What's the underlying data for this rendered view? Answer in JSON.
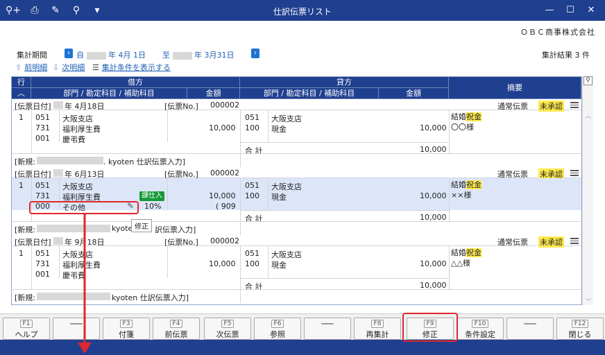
{
  "window": {
    "title": "仕訳伝票リスト",
    "toolbar_icons": [
      "search-add-icon",
      "print-icon",
      "pdf-icon",
      "preview-icon",
      "dropdown-icon"
    ],
    "minimize": "—",
    "maximize": "☐",
    "close": "✕"
  },
  "company": "ＯＢＣ商事株式会社",
  "period": {
    "label": "集計期間",
    "from_prefix": "自",
    "from_date": "年  4月 1日",
    "to_prefix": "至",
    "to_date": "年  3月31日"
  },
  "result": "集計結果 3 件",
  "links": {
    "prev": "前明細",
    "next": "次明細",
    "show_conditions": "集計条件を表示する"
  },
  "grid": {
    "col_row": "行",
    "col_debit": "借方",
    "col_credit": "貸方",
    "col_dept_account": "部門 / 勘定科目 / 補助科目",
    "col_amount": "金額",
    "col_summary": "摘要"
  },
  "slips": [
    {
      "date_label": "[伝票日付]",
      "date": "年  4月18日",
      "no_label": "[伝票No.]",
      "no": "000002",
      "type": "通常伝票",
      "status": "未承認",
      "row": "1",
      "debit": [
        [
          "051",
          "大阪支店"
        ],
        [
          "731",
          "福利厚生費"
        ],
        [
          "001",
          "慶弔費"
        ]
      ],
      "debit_amount": "10,000",
      "credit": [
        [
          "051",
          "大阪支店"
        ],
        [
          "100",
          "現金"
        ]
      ],
      "credit_amount": "10,000",
      "summary1_a": "結婚",
      "summary1_b": "祝金",
      "summary2": "〇〇様",
      "total_label": "合 計",
      "total": "10,000",
      "new_label": "[新規:",
      "new_user": ". kyoten  仕訳伝票入力]"
    },
    {
      "date_label": "[伝票日付]",
      "date": "年  6月13日",
      "no_label": "[伝票No.]",
      "no": "000002",
      "type": "通常伝票",
      "status": "未承認",
      "row": "1",
      "debit": [
        [
          "051",
          "大阪支店"
        ],
        [
          "731",
          "福利厚生費"
        ],
        [
          "000",
          "その他"
        ]
      ],
      "tax_badge": "課仕入",
      "tax_rate": "10%",
      "debit_amount": "10,000",
      "tax_amount": "( 909",
      "credit": [
        [
          "051",
          "大阪支店"
        ],
        [
          "100",
          "現金"
        ]
      ],
      "credit_amount": "10,000",
      "summary1_a": "結婚",
      "summary1_b": "祝金",
      "summary2": "××様",
      "total_label": "合 計",
      "total": "10,000",
      "new_label": "[新規:",
      "new_user": "kyoten",
      "new_user_tail": "訳伝票入力]",
      "tooltip": "修正"
    },
    {
      "date_label": "[伝票日付]",
      "date": "年  9月18日",
      "no_label": "[伝票No.]",
      "no": "000002",
      "type": "通常伝票",
      "status": "未承認",
      "row": "1",
      "debit": [
        [
          "051",
          "大阪支店"
        ],
        [
          "731",
          "福利厚生費"
        ],
        [
          "001",
          "慶弔費"
        ]
      ],
      "debit_amount": "10,000",
      "credit": [
        [
          "051",
          "大阪支店"
        ],
        [
          "100",
          "現金"
        ]
      ],
      "credit_amount": "10,000",
      "summary1_a": "結婚",
      "summary1_b": "祝金",
      "summary2": "△△様",
      "total_label": "合 計",
      "total": "10,000",
      "new_label": "[新規:",
      "new_user": "kyoten  仕訳伝票入力]"
    }
  ],
  "fkeys": [
    {
      "key": "F1",
      "label": "ヘルプ"
    },
    {
      "key": "",
      "label": ""
    },
    {
      "key": "F3",
      "label": "付箋"
    },
    {
      "key": "F4",
      "label": "前伝票"
    },
    {
      "key": "F5",
      "label": "次伝票"
    },
    {
      "key": "F6",
      "label": "参照"
    },
    {
      "key": "",
      "label": ""
    },
    {
      "key": "F8",
      "label": "再集計"
    },
    {
      "key": "F9",
      "label": "修正"
    },
    {
      "key": "F10",
      "label": "条件設定"
    },
    {
      "key": "",
      "label": ""
    },
    {
      "key": "F12",
      "label": "閉じる"
    }
  ],
  "colors": {
    "accent": "#1f3f8f",
    "highlight_row": "#dde6f8",
    "annotation_red": "#e0262e"
  }
}
